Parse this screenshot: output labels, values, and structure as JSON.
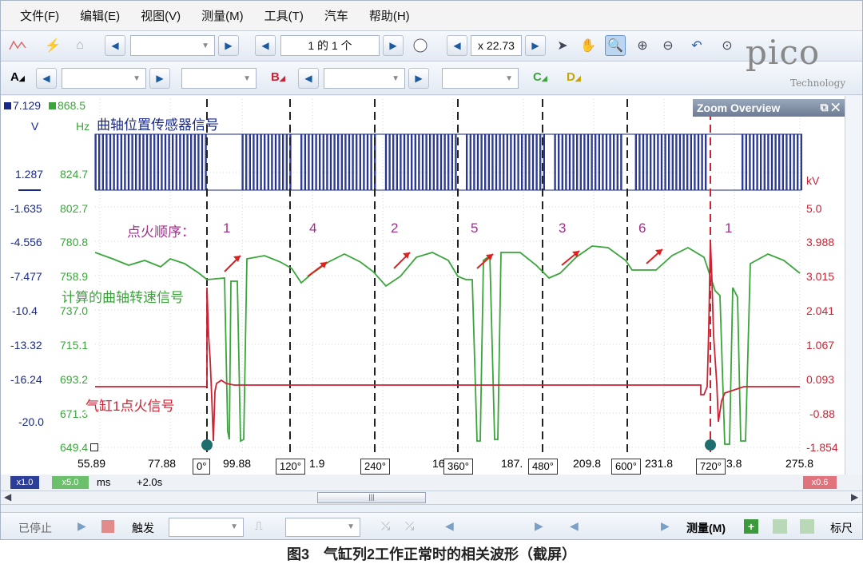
{
  "menu": [
    "文件(F)",
    "编辑(E)",
    "视图(V)",
    "测量(M)",
    "工具(T)",
    "汽车",
    "帮助(H)"
  ],
  "toolbar": {
    "page_indicator": "1 的 1 个",
    "zoom_value": "x 22.73",
    "channels": [
      "A",
      "B",
      "C",
      "D"
    ]
  },
  "logo": {
    "word": "pico",
    "sub": "Technology"
  },
  "zoom_overview": {
    "title": "Zoom Overview"
  },
  "axes": {
    "left_blue_top": "7.129",
    "left_green_top": "868.5",
    "unit_v": "V",
    "unit_hz": "Hz",
    "right_unit": "kV",
    "left_blue": [
      "1.287",
      "-1.635",
      "-4.556",
      "-7.477",
      "-10.4",
      "-13.32",
      "-16.24",
      "-20.0"
    ],
    "left_green": [
      "824.7",
      "802.7",
      "780.8",
      "758.9",
      "737.0",
      "715.1",
      "693.2",
      "671.3",
      "649.4"
    ],
    "right_red": [
      "5.0",
      "3.988",
      "3.015",
      "2.041",
      "1.067",
      "0.093",
      "-0.88",
      "-1.854"
    ],
    "x_ticks": [
      "55.89",
      "77.88",
      "99.88",
      "1.9",
      "16",
      "187.",
      "209.8",
      "231.8",
      "3.8",
      "275.8"
    ]
  },
  "labels": {
    "crank_signal": "曲轴位置传感器信号",
    "firing_order": "点火顺序：",
    "cylinders": [
      "1",
      "4",
      "2",
      "5",
      "3",
      "6",
      "1"
    ],
    "speed_signal": "计算的曲轴转速信号",
    "ignition_signal": "气缸1点火信号"
  },
  "angle_markers": [
    "0°",
    "120°",
    "240°",
    "360°",
    "480°",
    "600°",
    "720°"
  ],
  "status": {
    "blue_scale": "x1.0",
    "green_scale": "x5.0",
    "unit": "ms",
    "offset": "+2.0s",
    "red_scale": "x0.6"
  },
  "bottom": {
    "stop": "已停止",
    "trigger": "触发",
    "measure": "测量(M)",
    "ruler": "标尺"
  },
  "caption": "图3　气缸列2工作正常时的相关波形（截屏）",
  "colors": {
    "blue": "#1a2a8a",
    "green": "#3aa53a",
    "red": "#cc2233"
  }
}
